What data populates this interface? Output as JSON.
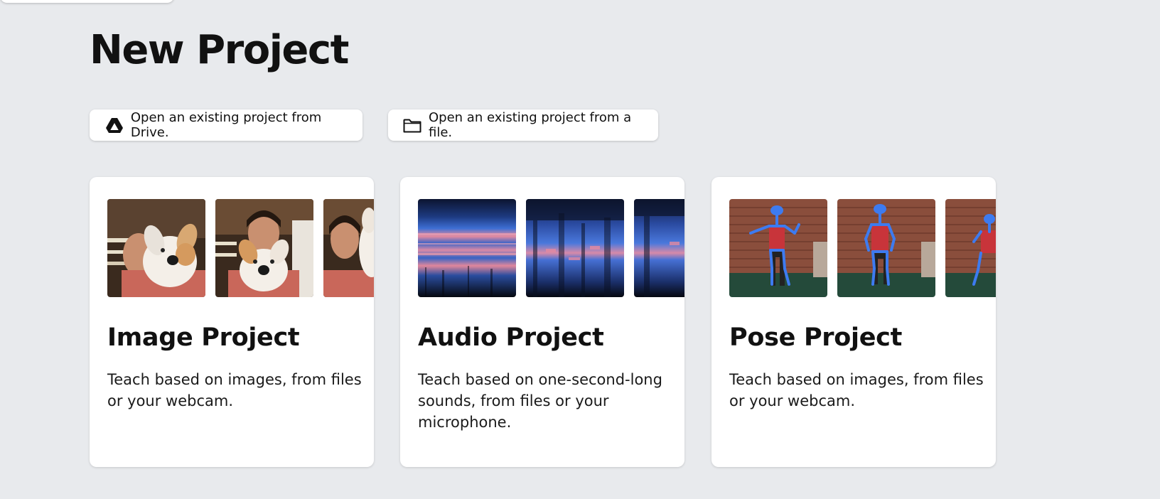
{
  "header": {
    "title": "New Project"
  },
  "open_actions": {
    "drive": {
      "label": "Open an existing project from Drive.",
      "icon": "google-drive-icon"
    },
    "file": {
      "label": "Open an existing project from a file.",
      "icon": "folder-icon"
    }
  },
  "projects": [
    {
      "title": "Image Project",
      "description": "Teach based on images, from files or your webcam.",
      "thumbnails": [
        "person-with-plush-dog",
        "person-with-plush-dog",
        "person-with-plush-dog"
      ]
    },
    {
      "title": "Audio Project",
      "description": "Teach based on one-second-long sounds, from files or your microphone.",
      "thumbnails": [
        "spectrogram",
        "spectrogram",
        "spectrogram"
      ]
    },
    {
      "title": "Pose Project",
      "description": "Teach based on images, from files or your webcam.",
      "thumbnails": [
        "pose-skeleton-brick-wall",
        "pose-skeleton-brick-wall",
        "pose-skeleton-brick-wall"
      ]
    }
  ],
  "colors": {
    "background": "#e8eaed",
    "card": "#ffffff",
    "text": "#111111",
    "spectrogram_blue": "#3b6fd8",
    "spectrogram_pink": "#e8889a",
    "pose_blue": "#3d7bf0"
  }
}
